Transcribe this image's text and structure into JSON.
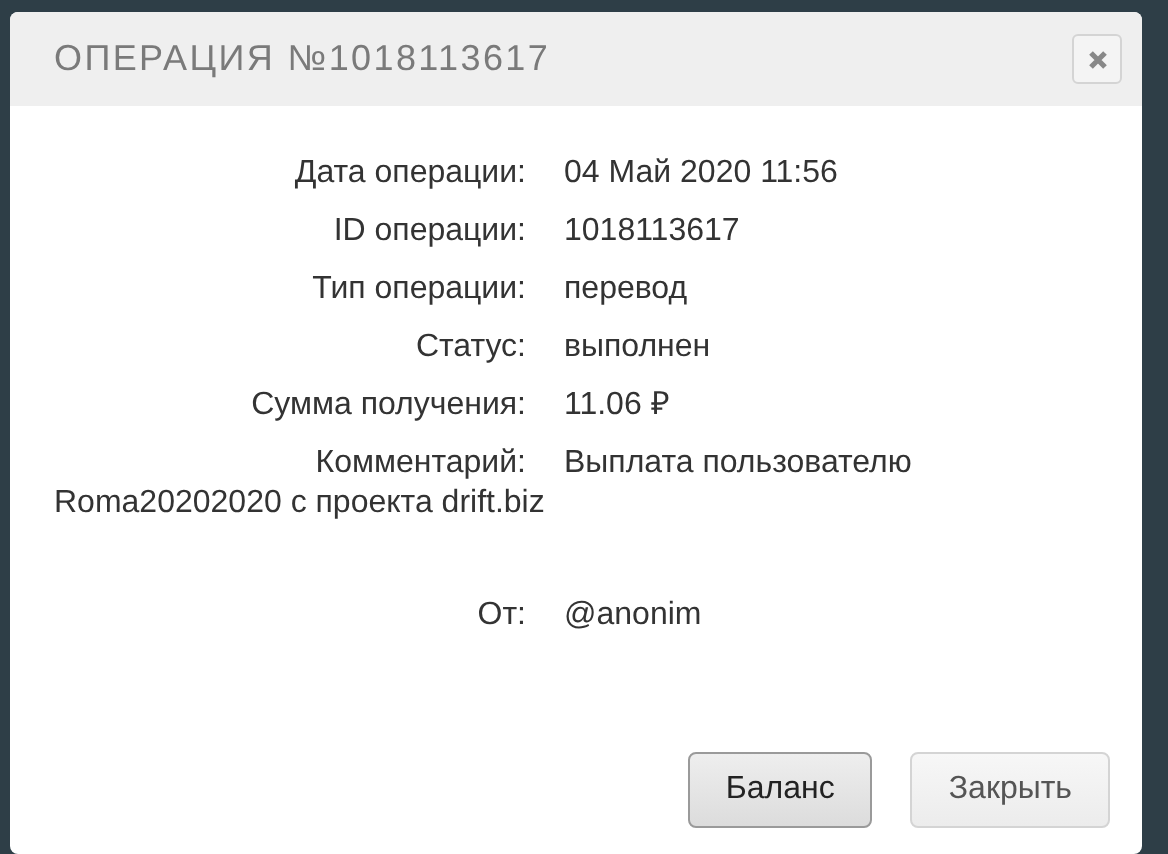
{
  "dialog": {
    "title": "ОПЕРАЦИЯ №1018113617",
    "fields": [
      {
        "label": "Дата операции:",
        "value": "04 Май 2020 11:56"
      },
      {
        "label": "ID операции:",
        "value": "1018113617"
      },
      {
        "label": "Тип операции:",
        "value": "перевод"
      },
      {
        "label": "Статус:",
        "value": "выполнен"
      },
      {
        "label": "Сумма получения:",
        "value": "11.06 ₽"
      },
      {
        "label": "Комментарий:",
        "value": "Выплата пользователю",
        "continuation": "Roma20202020 с проекта drift.biz"
      }
    ],
    "sender": {
      "label": "От:",
      "value": "@anonim"
    },
    "buttons": [
      {
        "label": "Баланс",
        "focused": true
      },
      {
        "label": "Закрыть",
        "focused": false
      }
    ]
  }
}
